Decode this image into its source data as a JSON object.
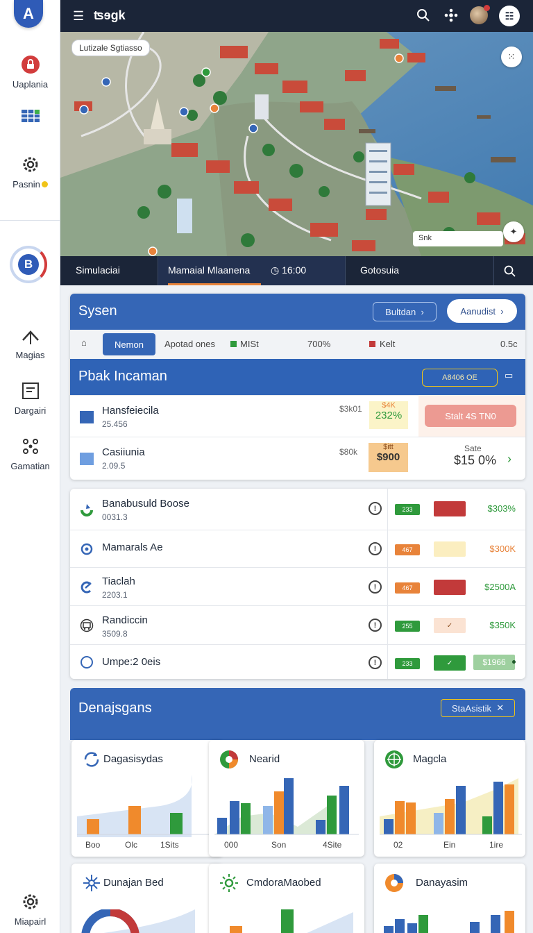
{
  "rail": {
    "items": [
      {
        "label": "Uaplania",
        "icon": "lock-icon"
      },
      {
        "label": "",
        "icon": "grid-icon"
      },
      {
        "label": "Pasnin",
        "icon": "gear-icon"
      },
      {
        "label": "Magias",
        "icon": "upload-icon"
      },
      {
        "label": "Dargairi",
        "icon": "document-icon"
      },
      {
        "label": "Gamatian",
        "icon": "network-icon"
      },
      {
        "label": "Miapairl",
        "icon": "gear-icon"
      }
    ],
    "badge": "B"
  },
  "topbar": {
    "title": "ʦɘgk"
  },
  "map": {
    "label": "Lutizale Sgtiasso",
    "search": "Snk"
  },
  "tabs": [
    {
      "label": "Simulaciai"
    },
    {
      "label": "Mamaial Mlaanena"
    },
    {
      "label": "◷ 16:00"
    },
    {
      "label": "Gotosuia"
    }
  ],
  "system": {
    "title": "Sysen",
    "btn_outline": "Bultdan",
    "btn_white": "Aanudist",
    "filter_active": "Nemon",
    "filter_1": "Apotad ones",
    "filter_2": "MISt",
    "filter_3": "700%",
    "filter_4": "Kelt",
    "filter_5": "0.5c"
  },
  "peak": {
    "title": "Pbak Incaman",
    "badge": "A8406 OE",
    "rows": [
      {
        "name": "Hansfeiecila",
        "sub": "25.456",
        "amount": "$3k01",
        "chip_top": "$4K",
        "chip_val": "232%",
        "color": "#3566b6"
      },
      {
        "name": "Casiiunia",
        "sub": "2.09.5",
        "amount": "$80k",
        "chip_top": "$itt",
        "chip_val": "$900",
        "color": "#6f9ee0"
      }
    ],
    "status_btn": "Stalt 4S TN0",
    "side_label": "Sate",
    "side_value": "$15 0%"
  },
  "list": [
    {
      "name": "Banabusuld Boose",
      "sub": "0031.3",
      "chip": "233",
      "chip_color": "#2f9a3c",
      "bar_color": "#c23a3a",
      "bar_text": "",
      "value": "$303%",
      "value_color": "#2f9a3c",
      "icon": "leaf-icon"
    },
    {
      "name": "Mamarals Ae",
      "sub": "",
      "chip": "467",
      "chip_color": "#e8833a",
      "bar_color": "#fbeec0",
      "bar_text": "",
      "value": "$300K",
      "value_color": "#e8833a",
      "icon": "target-icon"
    },
    {
      "name": "Tiaclah",
      "sub": "2203.1",
      "chip": "467",
      "chip_color": "#e8833a",
      "bar_color": "#c23a3a",
      "bar_text": "",
      "value": "$2500A",
      "value_color": "#2f9a3c",
      "icon": "leaf-icon"
    },
    {
      "name": "Randiccin",
      "sub": "3509.8",
      "chip": "255",
      "chip_color": "#2f9a3c",
      "bar_color": "#fbe3d3",
      "bar_text": "✓",
      "value": "$350K",
      "value_color": "#2f9a3c",
      "icon": "bus-icon"
    },
    {
      "name": "Umpe:2 0eis",
      "sub": "",
      "chip": "233",
      "chip_color": "#2f9a3c",
      "bar_color": "#2f9a3c",
      "bar_text": "✓",
      "value": "$1966",
      "value_color": "#2f9a3c",
      "icon": "circle-icon"
    }
  ],
  "dashboard": {
    "title": "Denajsgans",
    "tag": "StaAsistik",
    "cards": [
      {
        "title": "Dagasisydas",
        "icon": "refresh-icon",
        "axis": [
          "Boo",
          "Olc",
          "1Sits"
        ]
      },
      {
        "title": "Nearid",
        "icon": "pie-icon",
        "axis": [
          "000",
          "Son",
          "4Site"
        ]
      },
      {
        "title": "Magcla",
        "icon": "globe-icon",
        "axis": [
          "02",
          "Ein",
          "1ire"
        ]
      },
      {
        "title": "Dunajan Bed",
        "icon": "sparkle-icon",
        "axis": []
      },
      {
        "title": "CmdoraMaobed",
        "icon": "sun-icon",
        "axis": []
      },
      {
        "title": "Danayasim",
        "icon": "pie-icon",
        "axis": []
      }
    ]
  },
  "colors": {
    "navy": "#1b2538",
    "blue": "#3566b6",
    "orange": "#e8833a",
    "green": "#2f9a3c",
    "red": "#c23a3a"
  }
}
